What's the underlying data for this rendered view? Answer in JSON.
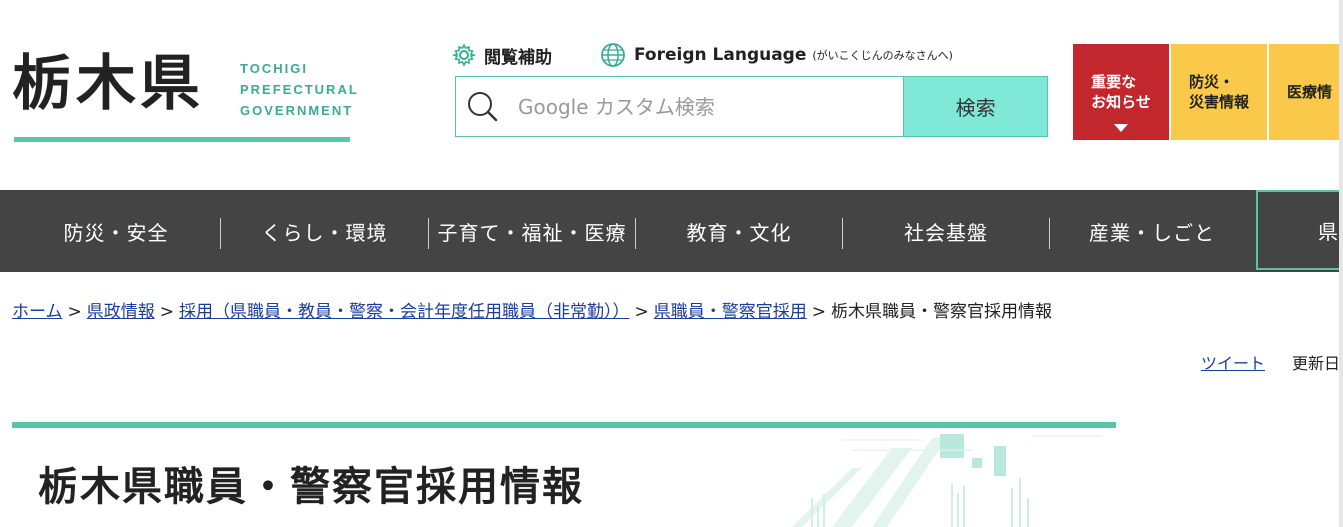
{
  "logo": {
    "kanji": "栃木県",
    "en_lines": [
      "TOCHIGI",
      "PREFECTURAL",
      "GOVERNMENT"
    ]
  },
  "utility": {
    "accessibility_label": "閲覧補助",
    "language_label": "Foreign Language",
    "language_sub": "(がいこくじんのみなさんへ)"
  },
  "search": {
    "placeholder": "Google カスタム検索",
    "button_label": "検索"
  },
  "tiles": {
    "emergency_line1": "重要な",
    "emergency_line2": "お知らせ",
    "disaster_line1": "防災・",
    "disaster_line2": "災害情報",
    "medical": "医療情"
  },
  "nav": {
    "items": [
      "防災・安全",
      "くらし・環境",
      "子育て・福祉・医療",
      "教育・文化",
      "社会基盤",
      "産業・しごと"
    ],
    "last": "県"
  },
  "breadcrumb": {
    "items": [
      "ホーム",
      "県政情報",
      "採用（県職員・教員・警察・会計年度任用職員（非常勤））",
      "県職員・警察官採用"
    ],
    "current": "栃木県職員・警察官採用情報",
    "separator": ">"
  },
  "tweet_label": "ツイート",
  "updated_label": "更新日",
  "page_title": "栃木県職員・警察官採用情報",
  "colors": {
    "accent": "#58c4a8",
    "nav_bg": "#444444",
    "emergency": "#c1272d",
    "yellow": "#fbc94a",
    "search_button": "#7fe8d6",
    "link": "#1a3e9c"
  }
}
